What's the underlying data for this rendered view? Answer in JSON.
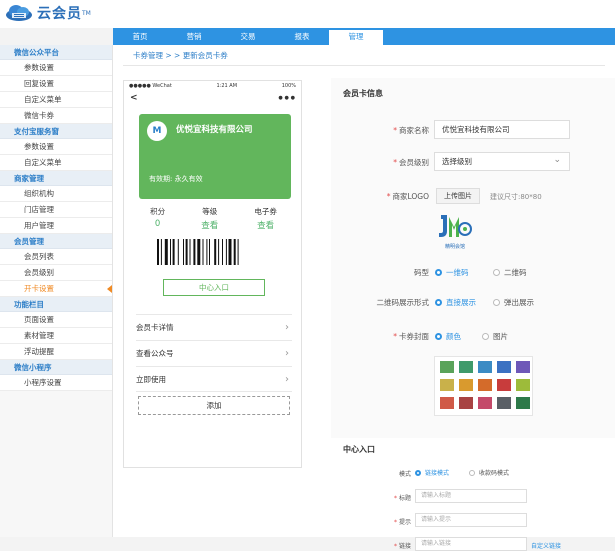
{
  "brand": {
    "name": "云会员",
    "tm": "TM"
  },
  "nav": [
    "首页",
    "营销",
    "交易",
    "报表",
    "管理"
  ],
  "nav_active": "管理",
  "sidebar": [
    {
      "head": "微信公众平台",
      "items": [
        "参数设置",
        "回复设置",
        "自定义菜单",
        "微信卡券"
      ]
    },
    {
      "head": "支付宝服务窗",
      "items": [
        "参数设置",
        "自定义菜单"
      ]
    },
    {
      "head": "商家管理",
      "items": [
        "组织机构",
        "门店管理",
        "用户管理"
      ]
    },
    {
      "head": "会员管理",
      "items": [
        "会员列表",
        "会员级别",
        "开卡设置"
      ]
    },
    {
      "head": "功能栏目",
      "items": [
        "页面设置",
        "素材管理",
        "浮动提醒"
      ]
    },
    {
      "head": "微信小程序",
      "items": [
        "小程序设置"
      ]
    }
  ],
  "sidebar_active": "开卡设置",
  "breadcrumb": "卡券管理 > > 更新会员卡券",
  "phone": {
    "carrier": "●●●●● WeChat",
    "time": "1:21 AM",
    "battery": "100%",
    "back": "<",
    "more": "● ● ●",
    "card_logo": "M",
    "card_name": "优悦宜科技有限公司",
    "card_valid": "有效期: 永久有效",
    "stats": [
      {
        "label": "积分",
        "value": "0"
      },
      {
        "label": "等级",
        "value": "查看"
      },
      {
        "label": "电子券",
        "value": "查看"
      }
    ],
    "center_button": "中心入口",
    "menu": [
      "会员卡详情",
      "查看公众号",
      "立即使用"
    ],
    "add_button": "添加"
  },
  "form": {
    "title": "会员卡信息",
    "merchant_label": "商家名称",
    "merchant_value": "优悦宜科技有限公司",
    "level_label": "会员级别",
    "level_value": "选择级别",
    "logo_label": "商家LOGO",
    "upload_label": "上传图片",
    "size_hint": "建议尺寸:80*80",
    "logo_caption": "精明会馆",
    "codetype_label": "码型",
    "codetype_options": [
      "一维码",
      "二维码"
    ],
    "display_label": "二维码展示形式",
    "display_options": [
      "直接展示",
      "弹出展示"
    ],
    "cover_label": "卡券封面",
    "cover_options": [
      "颜色",
      "图片"
    ],
    "swatches": [
      "#5aa35a",
      "#3f9a6b",
      "#3b8bc4",
      "#3b71c2",
      "#6e58b8",
      "#c9b14a",
      "#d99a2e",
      "#d46b2a",
      "#c83c3c",
      "#9dbb3a",
      "#d05a47",
      "#a84343",
      "#c44a6a",
      "#5a5f66",
      "#2e7a4a"
    ]
  },
  "center": {
    "title": "中心入口",
    "mode_label": "模式",
    "mode_options": [
      "链接模式",
      "收款码模式"
    ],
    "title_label": "标题",
    "title_placeholder": "请输入标题",
    "tip_label": "提示",
    "tip_placeholder": "请输入提示",
    "link_label": "链接",
    "link_placeholder": "请输入链接",
    "custom_link": "自定义链接"
  }
}
